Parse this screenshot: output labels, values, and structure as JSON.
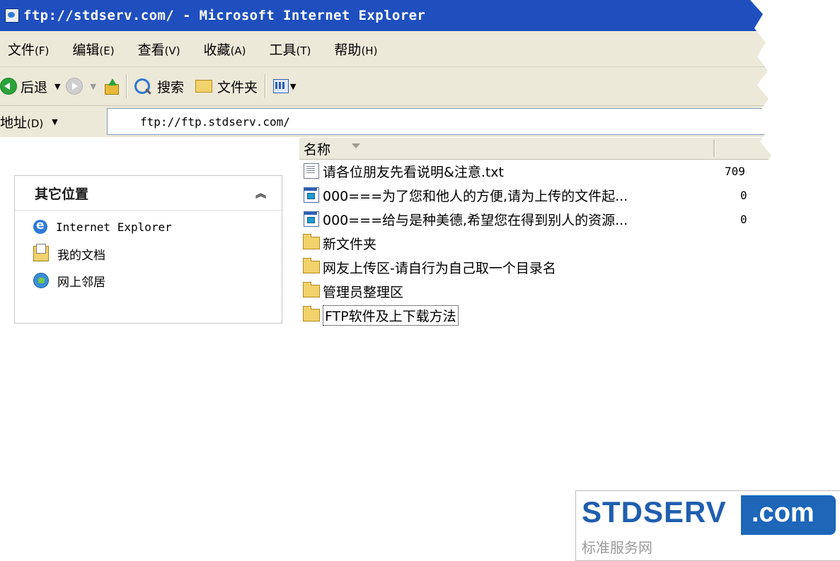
{
  "window": {
    "title": "ftp://stdserv.com/ - Microsoft Internet Explorer"
  },
  "menu": [
    {
      "label": "文件",
      "key": "(F)"
    },
    {
      "label": "编辑",
      "key": "(E)"
    },
    {
      "label": "查看",
      "key": "(V)"
    },
    {
      "label": "收藏",
      "key": "(A)"
    },
    {
      "label": "工具",
      "key": "(T)"
    },
    {
      "label": "帮助",
      "key": "(H)"
    }
  ],
  "toolbar": {
    "back_label": "后退",
    "search_label": "搜索",
    "folders_label": "文件夹"
  },
  "address": {
    "label": "地址",
    "key": "(D)",
    "value": "ftp://ftp.stdserv.com/"
  },
  "taskpane": {
    "title": "其它位置",
    "links": [
      {
        "label": "Internet Explorer",
        "icon": "ie-icon"
      },
      {
        "label": "我的文档",
        "icon": "my-documents-icon"
      },
      {
        "label": "网上邻居",
        "icon": "network-places-icon"
      }
    ]
  },
  "filelist": {
    "column_name": "名称",
    "rows": [
      {
        "name": "请各位朋友先看说明&注意.txt",
        "size": "709",
        "icon": "text-file-icon"
      },
      {
        "name": "000===为了您和他人的方便,请为上传的文件起...",
        "size": "0",
        "icon": "shortcut-file-icon"
      },
      {
        "name": "000===给与是种美德,希望您在得到别人的资源...",
        "size": "0",
        "icon": "shortcut-file-icon"
      },
      {
        "name": "新文件夹",
        "size": "",
        "icon": "folder-icon"
      },
      {
        "name": "网友上传区-请自行为自己取一个目录名",
        "size": "",
        "icon": "folder-icon"
      },
      {
        "name": "管理员整理区",
        "size": "",
        "icon": "folder-icon"
      },
      {
        "name": "FTP软件及上下载方法",
        "size": "",
        "icon": "folder-icon",
        "selected": true
      }
    ]
  },
  "watermark": {
    "brand": "STDSERV",
    "tld": ".com",
    "subtitle": "标准服务网",
    "brand_color": "#1f5eb0"
  }
}
